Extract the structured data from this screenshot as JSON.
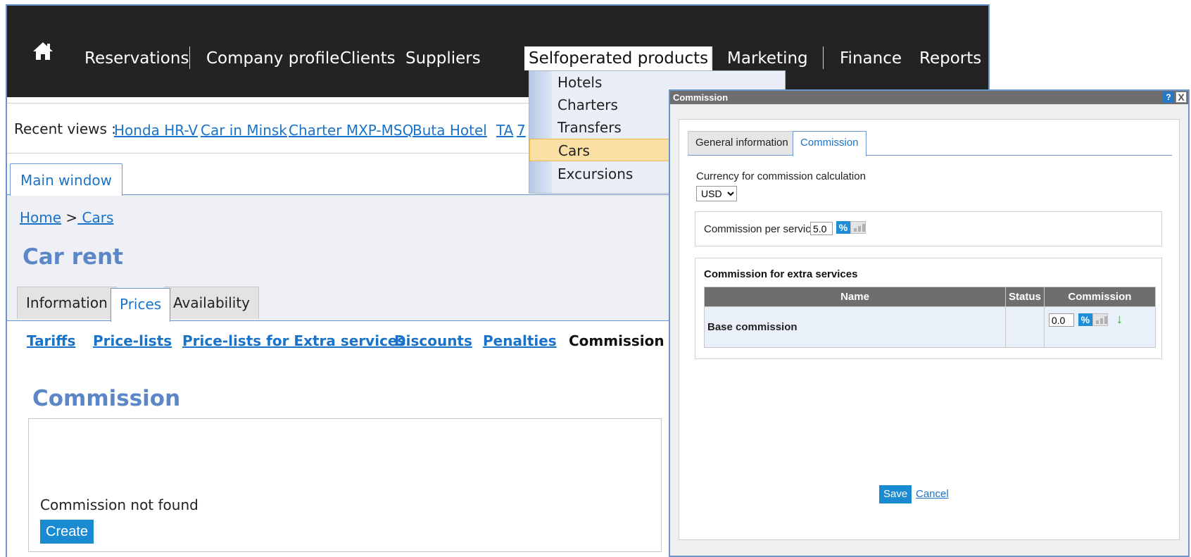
{
  "topnav": {
    "items": [
      "Reservations",
      "Company profile",
      "Clients",
      "Suppliers",
      "Selfoperated products",
      "Marketing",
      "Finance",
      "Reports"
    ],
    "active": "Selfoperated products",
    "home_icon": "home-icon"
  },
  "recent": {
    "label": "Recent views :",
    "links": [
      "Honda HR-V",
      "Car in Minsk",
      "Charter MXP-MSQ",
      "Buta Hotel",
      "TA",
      "7"
    ]
  },
  "dropdown": {
    "items": [
      "Hotels",
      "Charters",
      "Transfers",
      "Cars",
      "Excursions"
    ],
    "highlighted": "Cars"
  },
  "main_tab": "Main window",
  "breadcrumb": {
    "home": "Home",
    "separator": ">",
    "current": " Cars"
  },
  "page_title": "Car rent",
  "sub_tabs": [
    "Information",
    "Prices",
    "Availability"
  ],
  "sub_tab_active": "Prices",
  "price_links": [
    "Tariffs",
    "Price-lists",
    "Price-lists for Extra services",
    "Discounts",
    "Penalties",
    "Commission"
  ],
  "price_link_current": "Commission",
  "section": {
    "title": "Commission",
    "empty_text": "Commission not found",
    "create_label": "Create"
  },
  "dialog": {
    "title": "Commission",
    "help": "?",
    "close": "X",
    "tabs": [
      "General information",
      "Commission"
    ],
    "active_tab": "Commission",
    "currency_label": "Currency for commission calculation",
    "currency_value": "USD",
    "per_service_label": "Commission per service",
    "per_service_value": "5.0",
    "extra_title": "Commission for extra services",
    "table_headers": [
      "Name",
      "Status",
      "Commission"
    ],
    "table_rows": [
      {
        "name": "Base commission",
        "status": "",
        "commission": "0.0"
      }
    ],
    "save_label": "Save",
    "cancel_label": "Cancel",
    "percent_symbol": "%"
  },
  "colors": {
    "accent": "#1b8bd1",
    "title_blue": "#5b87c8",
    "nav_bg": "#232323",
    "dropdown_hover": "#fbe0a6",
    "dialog_header": "#6e6e6e"
  }
}
